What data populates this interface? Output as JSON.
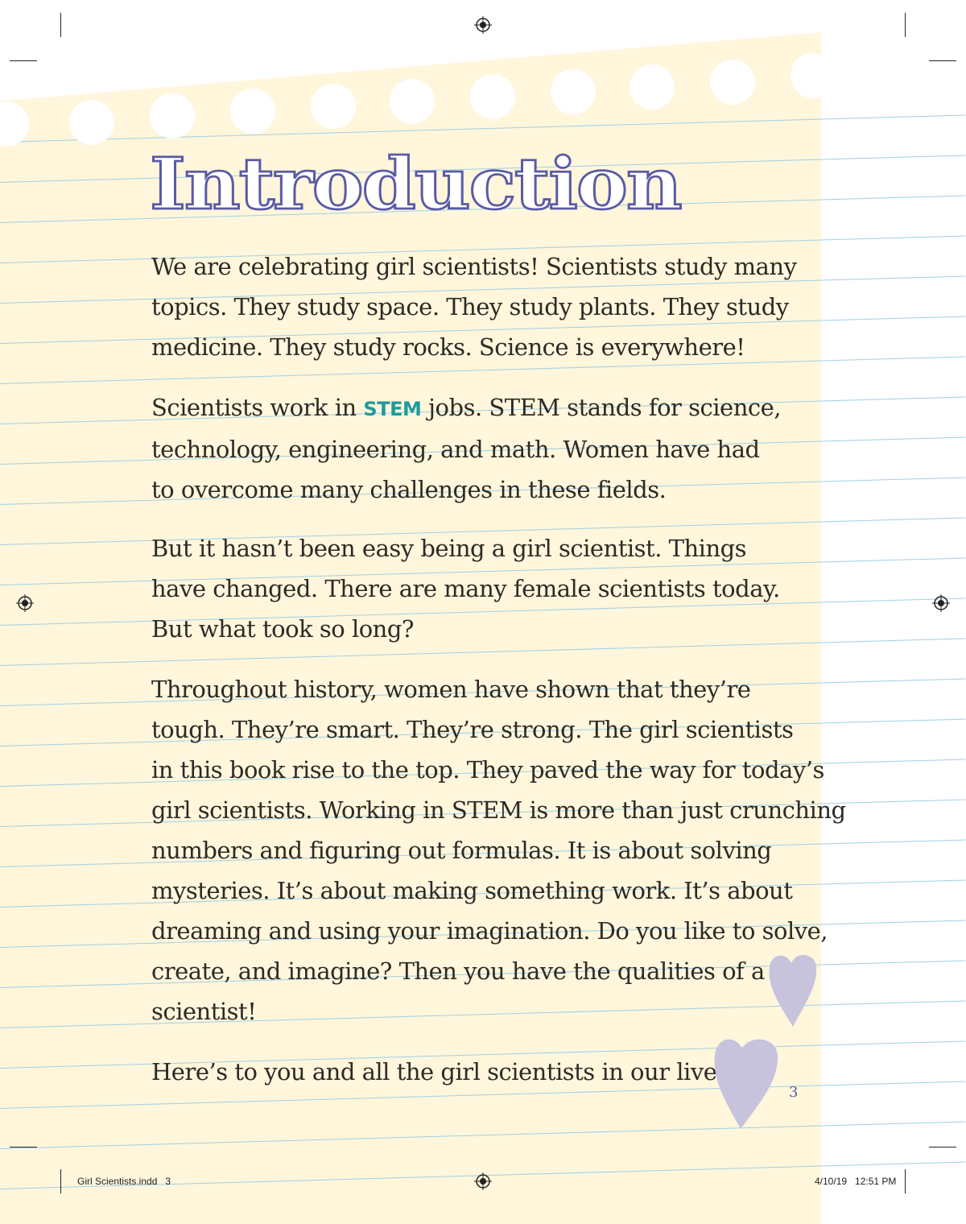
{
  "title": "Introduction",
  "paragraphs": [
    [
      "We are celebrating girl scientists! Scientists study many",
      "topics. They study space. They study plants. They study",
      "medicine. They study rocks. Science is everywhere!"
    ],
    [
      "Scientists work in STEM jobs. STEM stands for science,",
      "technology, engineering, and math. Women have had",
      "to overcome many challenges in these fields."
    ],
    [
      "But it hasn’t been easy being a girl scientist. Things",
      "have changed. There are many female scientists today.",
      "But what took so long?"
    ],
    [
      "Throughout history, women have shown that they’re",
      "tough. They’re smart. They’re strong. The girl scientists",
      "in this book rise to the top. They paved the way for today’s",
      "girl scientists. Working in STEM is more than just crunching",
      "numbers and figuring out formulas. It is about solving",
      "mysteries. It’s about making something work. It’s about",
      "dreaming and using your imagination. Do you like to solve,",
      "create, and imagine? Then you have the qualities of a",
      "scientist!"
    ],
    [
      "Here’s to you and all the girl scientists in our lives!"
    ]
  ],
  "stem_line": {
    "before": "Scientists work in ",
    "term": "STEM",
    "after": " jobs. STEM stands for science,"
  },
  "page_number": "3",
  "slug": {
    "file": "Girl Scientists.indd   3",
    "date": "4/10/19   12:51 PM"
  },
  "colors": {
    "paper": "#fff6dc",
    "title_outline": "#5a5aa6",
    "stem_term": "#1f9b9b",
    "heart": "#c7c3dd",
    "rule": "#9fd0e6"
  }
}
